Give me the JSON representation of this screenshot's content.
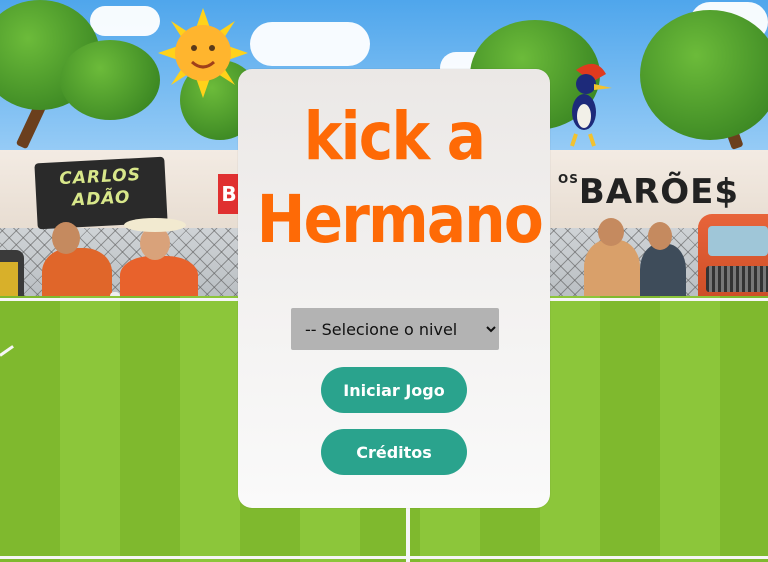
{
  "game": {
    "title_line1": "kick a",
    "title_line2": "Hermano"
  },
  "menu": {
    "level_select_placeholder": "-- Selecione o nivel",
    "start_button": "Iniciar Jogo",
    "credits_button": "Créditos"
  },
  "background": {
    "sign_left": "CARLOS ADÃO",
    "sign_right_small": "OS",
    "sign_right": "BARÕE$",
    "sign_partial": "B",
    "colors": {
      "title": "#fe6a06",
      "button": "#2aa38d",
      "select": "#b3b3b3",
      "grass_light": "#8cc63a",
      "grass_dark": "#7fb92e",
      "sky": "#4fa6ec"
    },
    "icons": [
      "sun-face-icon",
      "woodpecker-icon",
      "truck-icon"
    ]
  }
}
